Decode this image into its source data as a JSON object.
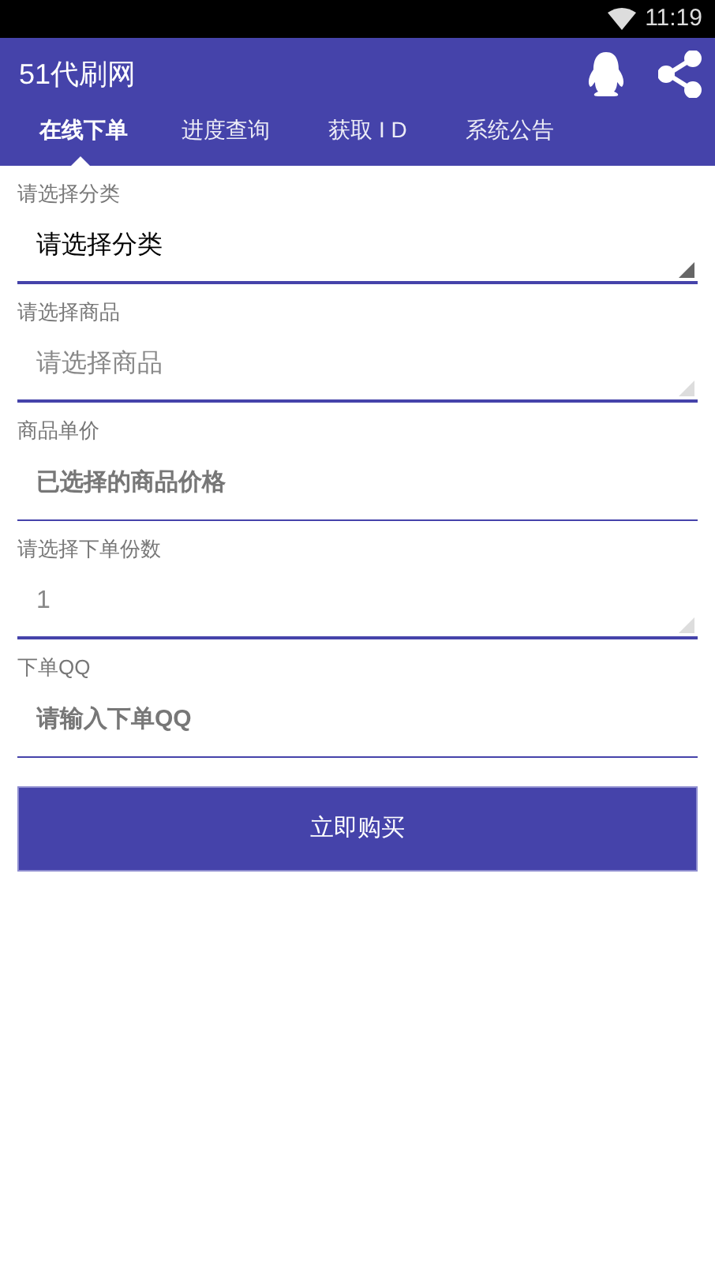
{
  "status_bar": {
    "time": "11:19"
  },
  "app_bar": {
    "title": "51代刷网"
  },
  "tabs": [
    {
      "label": "在线下单",
      "selected": true
    },
    {
      "label": "进度查询",
      "selected": false
    },
    {
      "label": "获取 I D",
      "selected": false
    },
    {
      "label": "系统公告",
      "selected": false
    }
  ],
  "form": [
    {
      "kind": "spinner",
      "label": "请选择分类",
      "value": "请选择分类",
      "disabled": false
    },
    {
      "kind": "spinner",
      "label": "请选择商品",
      "value": "请选择商品",
      "disabled": true
    },
    {
      "kind": "input",
      "label": "商品单价",
      "placeholder": "已选择的商品价格"
    },
    {
      "kind": "spinner",
      "label": "请选择下单份数",
      "value": "1",
      "disabled": true
    },
    {
      "kind": "input",
      "label": "下单QQ",
      "placeholder": "请输入下单QQ"
    }
  ],
  "buy_button": "立即购买"
}
